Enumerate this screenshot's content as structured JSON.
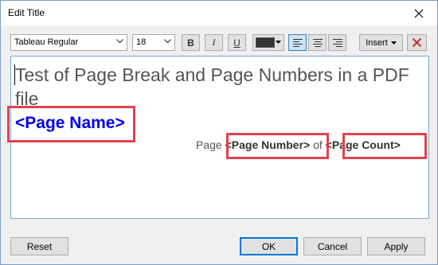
{
  "window": {
    "title": "Edit Title"
  },
  "toolbar": {
    "font_family": "Tableau Regular",
    "font_size": "18",
    "bold_label": "B",
    "italic_label": "I",
    "underline_label": "U",
    "text_color": "#333333",
    "insert_label": "Insert"
  },
  "editor": {
    "body_text": "Test of Page Break and Page Numbers in a PDF file",
    "page_name_field": "<Page Name>",
    "footer_prefix": "Page",
    "page_number_field": "<Page Number>",
    "footer_of": "of",
    "page_count_field": "<Page Count>"
  },
  "buttons": {
    "reset": "Reset",
    "ok": "OK",
    "cancel": "Cancel",
    "apply": "Apply"
  },
  "colors": {
    "highlight": "#e0424f",
    "field_blue": "#0000ee"
  }
}
